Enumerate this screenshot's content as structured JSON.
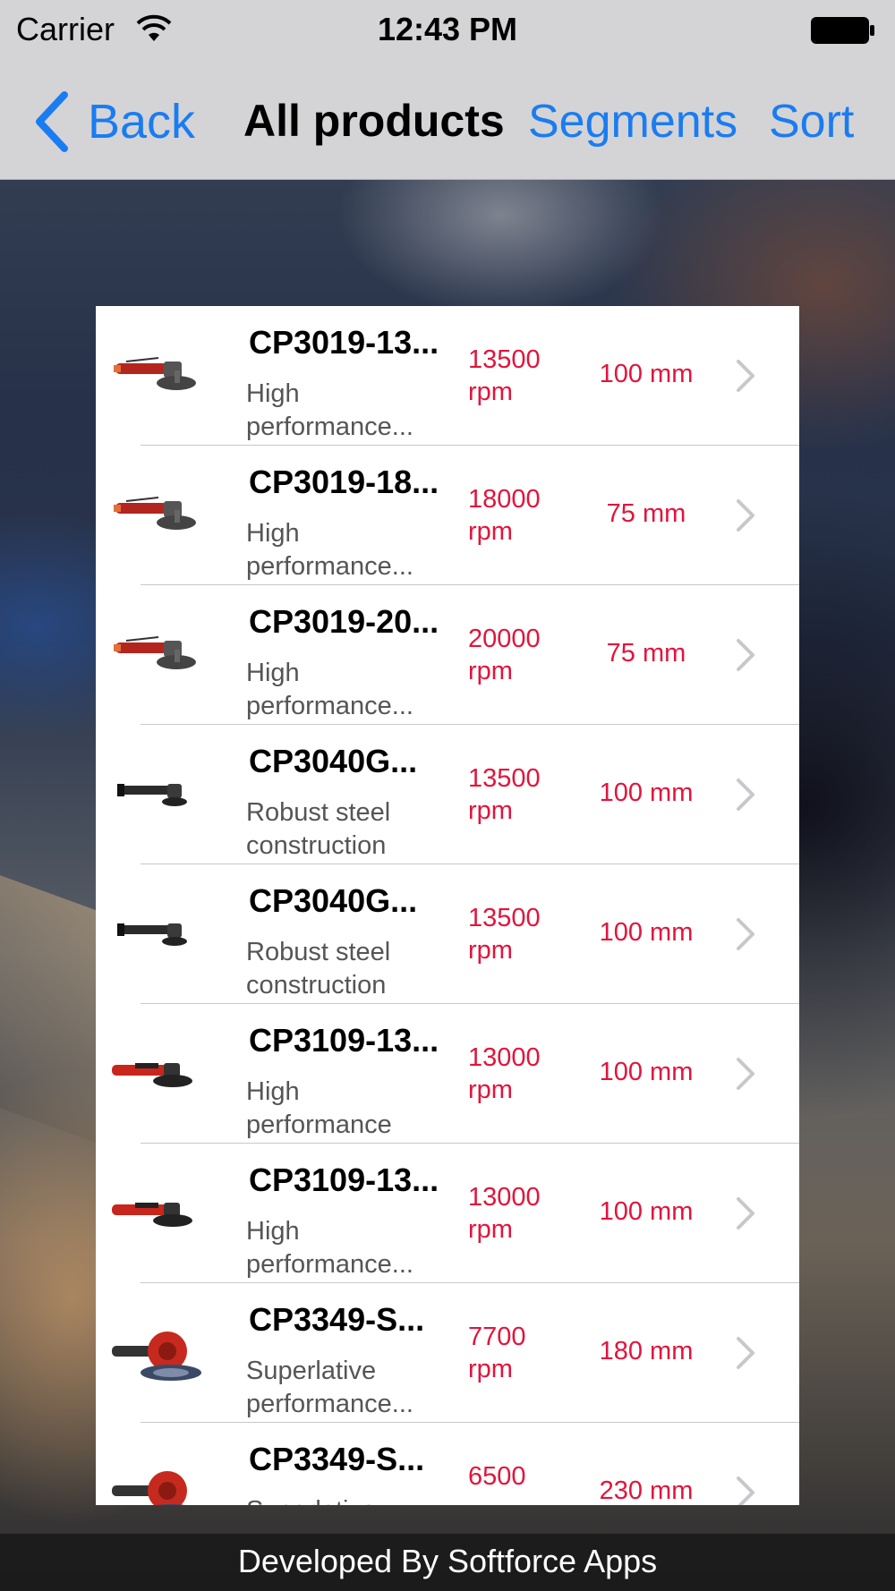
{
  "status_bar": {
    "carrier": "Carrier",
    "time": "12:43 PM",
    "wifi_icon": "wifi-icon",
    "battery_icon": "battery-icon"
  },
  "nav_bar": {
    "back_label": "Back",
    "title": "All products",
    "segments_label": "Segments",
    "sort_label": "Sort",
    "accent_color": "#1a7cf2"
  },
  "products": [
    {
      "name": "CP3019-13...",
      "desc_line1": "High",
      "desc_line2": "performance...",
      "speed_value": "13500",
      "speed_unit": "rpm",
      "size": "100 mm",
      "thumb": "angle-grinder-red-icon"
    },
    {
      "name": "CP3019-18...",
      "desc_line1": "High",
      "desc_line2": "performance...",
      "speed_value": "18000",
      "speed_unit": "rpm",
      "size": "75 mm",
      "thumb": "angle-grinder-red-icon"
    },
    {
      "name": "CP3019-20...",
      "desc_line1": "High",
      "desc_line2": "performance...",
      "speed_value": "20000",
      "speed_unit": "rpm",
      "size": "75 mm",
      "thumb": "angle-grinder-red-icon"
    },
    {
      "name": "CP3040G...",
      "desc_line1": "Robust steel",
      "desc_line2": "construction",
      "speed_value": "13500",
      "speed_unit": "rpm",
      "size": "100 mm",
      "thumb": "angle-grinder-steel-icon"
    },
    {
      "name": "CP3040G...",
      "desc_line1": "Robust steel",
      "desc_line2": "construction",
      "speed_value": "13500",
      "speed_unit": "rpm",
      "size": "100 mm",
      "thumb": "angle-grinder-steel-icon"
    },
    {
      "name": "CP3109-13...",
      "desc_line1": "High",
      "desc_line2": "performance",
      "speed_value": "13000",
      "speed_unit": "rpm",
      "size": "100 mm",
      "thumb": "angle-grinder-red-black-icon"
    },
    {
      "name": "CP3109-13...",
      "desc_line1": "High",
      "desc_line2": "performance...",
      "speed_value": "13000",
      "speed_unit": "rpm",
      "size": "100 mm",
      "thumb": "angle-grinder-red-black-icon"
    },
    {
      "name": "CP3349-S...",
      "desc_line1": "Superlative",
      "desc_line2": "performance...",
      "speed_value": "7700",
      "speed_unit": "rpm",
      "size": "180 mm",
      "thumb": "large-grinder-icon"
    },
    {
      "name": "CP3349-S...",
      "desc_line1": "Superlative",
      "desc_line2": "",
      "speed_value": "6500",
      "speed_unit": "",
      "size": "230 mm",
      "thumb": "large-grinder-icon"
    }
  ],
  "value_color": "#e2143c",
  "footer": {
    "text": "Developed By Softforce Apps"
  }
}
